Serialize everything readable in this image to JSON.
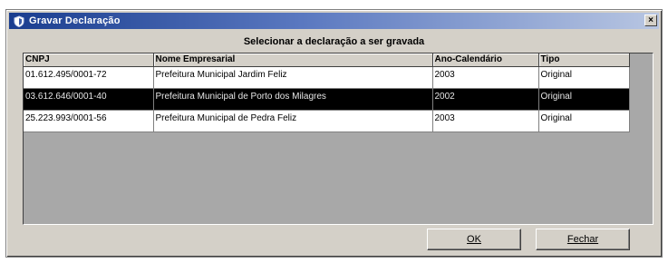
{
  "window": {
    "title": "Gravar Declaração",
    "close_glyph": "×"
  },
  "heading": "Selecionar a declaração a ser gravada",
  "table": {
    "columns": [
      "CNPJ",
      "Nome Empresarial",
      "Ano-Calendário",
      "Tipo"
    ],
    "rows": [
      [
        "01.612.495/0001-72",
        "Prefeitura Municipal Jardim Feliz",
        "2003",
        "Original"
      ],
      [
        "03.612.646/0001-40",
        "Prefeitura Municipal de Porto dos Milagres",
        "2002",
        "Original"
      ],
      [
        "25.223.993/0001-56",
        "Prefeitura Municipal de Pedra Feliz",
        "2003",
        "Original"
      ]
    ],
    "selected_row": 1
  },
  "buttons": {
    "ok_label": "OK",
    "close_label": "Fechar"
  },
  "colors": {
    "title_bar_start": "#1a3d8f",
    "selection": "#000000",
    "list_background": "#a8a8a8"
  },
  "icons": {
    "title_icon": "app-shield-icon"
  }
}
